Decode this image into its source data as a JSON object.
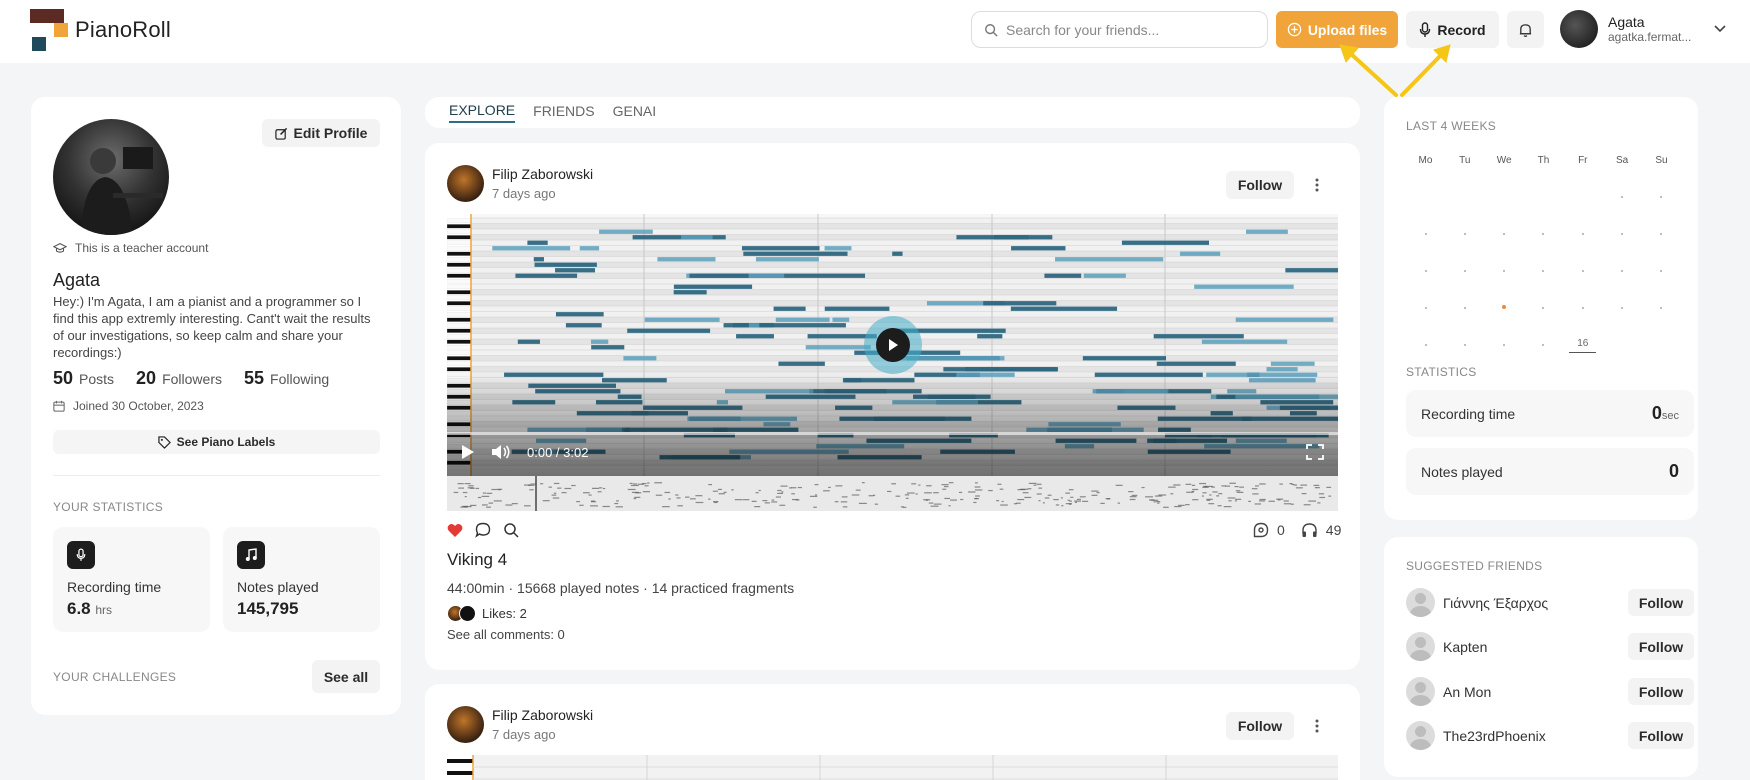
{
  "app": {
    "name": "PianoRoll"
  },
  "header": {
    "search_placeholder": "Search for your friends...",
    "upload_label": "Upload files",
    "record_label": "Record",
    "user_name": "Agata",
    "user_handle": "agatka.fermat..."
  },
  "profile": {
    "edit_label": "Edit Profile",
    "teacher_note": "This is a teacher account",
    "name": "Agata",
    "bio": "Hey:) I'm Agata, I am a pianist and a programmer so I find this app extremly interesting. Cant't wait the results of our investigations, so keep calm and share your recordings:)",
    "posts_count": "50",
    "posts_label": "Posts",
    "followers_count": "20",
    "followers_label": "Followers",
    "following_count": "55",
    "following_label": "Following",
    "joined": "Joined 30 October, 2023",
    "labels_button": "See Piano Labels",
    "stats_title": "YOUR STATISTICS",
    "recording_label": "Recording time",
    "recording_value": "6.8",
    "recording_unit": "hrs",
    "notes_label": "Notes played",
    "notes_value": "145,795",
    "challenges_title": "YOUR CHALLENGES",
    "see_all": "See all"
  },
  "tabs": [
    {
      "label": "EXPLORE",
      "active": true
    },
    {
      "label": "FRIENDS",
      "active": false
    },
    {
      "label": "GENAI",
      "active": false
    }
  ],
  "post": {
    "author": "Filip Zaborowski",
    "time": "7 days ago",
    "follow_label": "Follow",
    "player_time": "0:00 / 3:02",
    "played_fraction": 0,
    "title": "Viking 4",
    "meta": "44:00min · 15668 played notes · 14 practiced fragments",
    "likes_text": "Likes: 2",
    "comments_text": "See all comments: 0",
    "reposts": "0",
    "listens": "49"
  },
  "post2": {
    "author": "Filip Zaborowski",
    "time": "7 days ago",
    "follow_label": "Follow"
  },
  "calendar": {
    "title": "LAST 4 WEEKS",
    "days": [
      "Mo",
      "Tu",
      "We",
      "Th",
      "Fr",
      "Sa",
      "Su"
    ],
    "today_label": "16",
    "stats_title": "STATISTICS",
    "recording_label": "Recording time",
    "recording_value": "0",
    "recording_unit": "sec",
    "notes_label": "Notes played",
    "notes_value": "0"
  },
  "suggested": {
    "title": "SUGGESTED FRIENDS",
    "follow_label": "Follow",
    "friends": [
      "Γιάννης Έξαρχος",
      "Kapten",
      "An Mon",
      "The23rdPhoenix"
    ]
  },
  "colors": {
    "accent": "#f0a43a",
    "note_blue": "#2f6d87",
    "brand_dark": "#5b2a23",
    "brand_teal": "#1f4a5c",
    "heart": "#e53935"
  },
  "icons": [
    "search-icon",
    "upload-icon",
    "mic-icon",
    "bell-icon",
    "chevron-down-icon",
    "edit-icon",
    "graduation-cap-icon",
    "calendar-icon",
    "tag-icon",
    "music-note-icon",
    "heart-icon",
    "comment-icon",
    "magnifier-icon",
    "repost-icon",
    "headphones-icon",
    "more-vertical-icon",
    "play-icon",
    "volume-icon",
    "fullscreen-icon"
  ]
}
